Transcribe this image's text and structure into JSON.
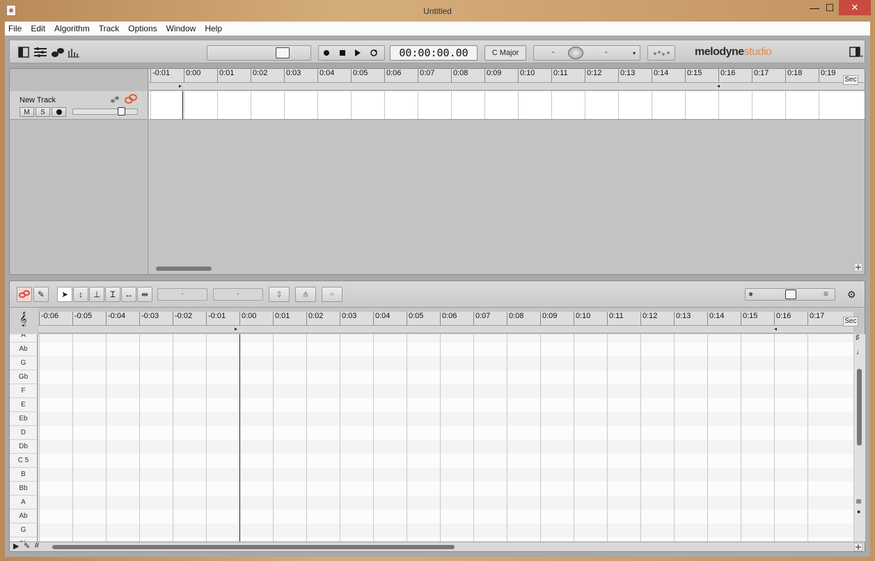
{
  "window": {
    "title": "Untitled",
    "min_glyph": "—",
    "max_glyph": "☐",
    "close_glyph": "✕"
  },
  "menu": [
    "File",
    "Edit",
    "Algorithm",
    "Track",
    "Options",
    "Window",
    "Help"
  ],
  "transport": {
    "timecode": "00:00:00.00",
    "key": "C Major",
    "pitch_left": "-",
    "pitch_right": "-"
  },
  "brand": {
    "name": "melodyne",
    "edition": "studio"
  },
  "arrange": {
    "ruler_ticks": [
      "-0:01",
      "0:00",
      "0:01",
      "0:02",
      "0:03",
      "0:04",
      "0:05",
      "0:06",
      "0:07",
      "0:08",
      "0:09",
      "0:10",
      "0:11",
      "0:12",
      "0:13",
      "0:14",
      "0:15",
      "0:16",
      "0:17",
      "0:18",
      "0:19"
    ],
    "unit": "Sec",
    "track": {
      "name": "New Track",
      "mute": "M",
      "solo": "S"
    }
  },
  "editor": {
    "field1": "-",
    "field2": "-",
    "ruler_ticks": [
      "-0:06",
      "-0:05",
      "-0:04",
      "-0:03",
      "-0:02",
      "-0:01",
      "0:00",
      "0:01",
      "0:02",
      "0:03",
      "0:04",
      "0:05",
      "0:06",
      "0:07",
      "0:08",
      "0:09",
      "0:10",
      "0:11",
      "0:12",
      "0:13",
      "0:14",
      "0:15",
      "0:16",
      "0:17"
    ],
    "unit": "Sec",
    "pitches": [
      "A",
      "Ab",
      "G",
      "Gb",
      "F",
      "E",
      "Eb",
      "D",
      "Db",
      "C 5",
      "B",
      "Bb",
      "A",
      "Ab",
      "G",
      "Gb"
    ]
  },
  "colors": {
    "accent": "#e08a50",
    "close": "#c74b3f"
  }
}
